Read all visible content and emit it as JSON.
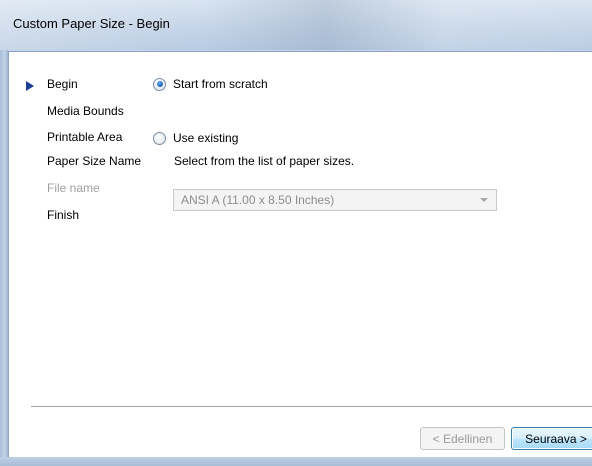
{
  "window": {
    "title": "Custom Paper Size - Begin"
  },
  "steps": {
    "current_indicator": "arrow-right",
    "items": [
      {
        "label": "Begin",
        "current": true,
        "enabled": true
      },
      {
        "label": "Media Bounds",
        "current": false,
        "enabled": true
      },
      {
        "label": "Printable Area",
        "current": false,
        "enabled": true
      },
      {
        "label": "Paper Size Name",
        "current": false,
        "enabled": true
      },
      {
        "label": "File name",
        "current": false,
        "enabled": false
      },
      {
        "label": "Finish",
        "current": false,
        "enabled": true
      }
    ]
  },
  "options": {
    "start_from_scratch": {
      "label": "Start from scratch",
      "selected": true
    },
    "use_existing": {
      "label": "Use existing",
      "selected": false
    },
    "hint": "Select from the list of paper sizes.",
    "paper_size_select": {
      "value": "ANSI A (11.00 x 8.50 Inches)",
      "enabled": false
    }
  },
  "buttons": {
    "previous": "< Edellinen",
    "next": "Seuraava >"
  },
  "colors": {
    "accent": "#1c3f95",
    "disabled_text": "#a0a0a0",
    "default_button_border": "#3c7fb1"
  }
}
